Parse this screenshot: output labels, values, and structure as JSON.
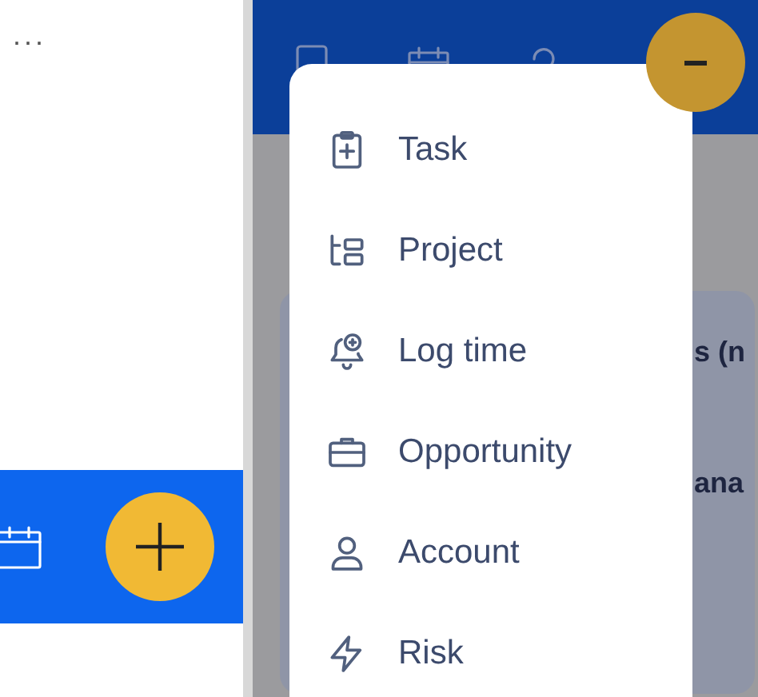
{
  "left_panel": {
    "more": "...",
    "fab": {
      "expanded": false
    }
  },
  "right_panel": {
    "card_texts": [
      "s (n",
      "ana"
    ],
    "fab": {
      "expanded": true
    }
  },
  "create_menu": {
    "items": [
      {
        "label": "Task"
      },
      {
        "label": "Project"
      },
      {
        "label": "Log time"
      },
      {
        "label": "Opportunity"
      },
      {
        "label": "Account"
      },
      {
        "label": "Risk"
      }
    ]
  }
}
